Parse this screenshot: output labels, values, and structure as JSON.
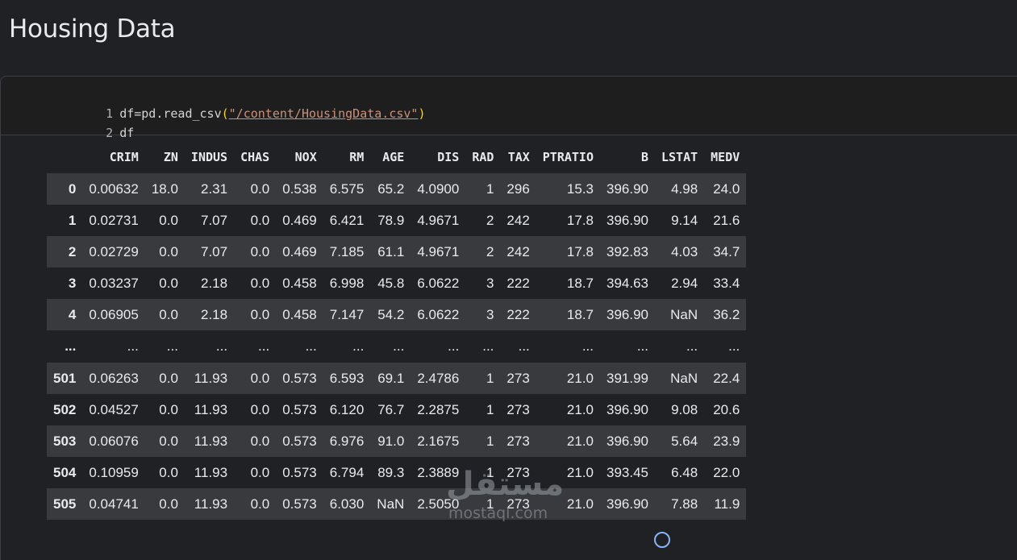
{
  "heading": "Housing Data",
  "code": {
    "lines": [
      {
        "num": "1",
        "pre": "df=pd.read_csv",
        "open": "(",
        "str": "\"/content/HousingData.csv\"",
        "close": ")"
      },
      {
        "num": "2",
        "text": "df"
      }
    ]
  },
  "table": {
    "columns": [
      "",
      "CRIM",
      "ZN",
      "INDUS",
      "CHAS",
      "NOX",
      "RM",
      "AGE",
      "DIS",
      "RAD",
      "TAX",
      "PTRATIO",
      "B",
      "LSTAT",
      "MEDV"
    ],
    "rows": [
      [
        "0",
        "0.00632",
        "18.0",
        "2.31",
        "0.0",
        "0.538",
        "6.575",
        "65.2",
        "4.0900",
        "1",
        "296",
        "15.3",
        "396.90",
        "4.98",
        "24.0"
      ],
      [
        "1",
        "0.02731",
        "0.0",
        "7.07",
        "0.0",
        "0.469",
        "6.421",
        "78.9",
        "4.9671",
        "2",
        "242",
        "17.8",
        "396.90",
        "9.14",
        "21.6"
      ],
      [
        "2",
        "0.02729",
        "0.0",
        "7.07",
        "0.0",
        "0.469",
        "7.185",
        "61.1",
        "4.9671",
        "2",
        "242",
        "17.8",
        "392.83",
        "4.03",
        "34.7"
      ],
      [
        "3",
        "0.03237",
        "0.0",
        "2.18",
        "0.0",
        "0.458",
        "6.998",
        "45.8",
        "6.0622",
        "3",
        "222",
        "18.7",
        "394.63",
        "2.94",
        "33.4"
      ],
      [
        "4",
        "0.06905",
        "0.0",
        "2.18",
        "0.0",
        "0.458",
        "7.147",
        "54.2",
        "6.0622",
        "3",
        "222",
        "18.7",
        "396.90",
        "NaN",
        "36.2"
      ],
      [
        "...",
        "...",
        "...",
        "...",
        "...",
        "...",
        "...",
        "...",
        "...",
        "...",
        "...",
        "...",
        "...",
        "...",
        "..."
      ],
      [
        "501",
        "0.06263",
        "0.0",
        "11.93",
        "0.0",
        "0.573",
        "6.593",
        "69.1",
        "2.4786",
        "1",
        "273",
        "21.0",
        "391.99",
        "NaN",
        "22.4"
      ],
      [
        "502",
        "0.04527",
        "0.0",
        "11.93",
        "0.0",
        "0.573",
        "6.120",
        "76.7",
        "2.2875",
        "1",
        "273",
        "21.0",
        "396.90",
        "9.08",
        "20.6"
      ],
      [
        "503",
        "0.06076",
        "0.0",
        "11.93",
        "0.0",
        "0.573",
        "6.976",
        "91.0",
        "2.1675",
        "1",
        "273",
        "21.0",
        "396.90",
        "5.64",
        "23.9"
      ],
      [
        "504",
        "0.10959",
        "0.0",
        "11.93",
        "0.0",
        "0.573",
        "6.794",
        "89.3",
        "2.3889",
        "1",
        "273",
        "21.0",
        "393.45",
        "6.48",
        "22.0"
      ],
      [
        "505",
        "0.04741",
        "0.0",
        "11.93",
        "0.0",
        "0.573",
        "6.030",
        "NaN",
        "2.5050",
        "1",
        "273",
        "21.0",
        "396.90",
        "7.88",
        "11.9"
      ]
    ]
  },
  "watermark": {
    "arabic": "مستقل",
    "latin": "mostaql.com"
  },
  "colors": {
    "background": "#202124",
    "stripe": "#383a3e",
    "string": "#ce9178",
    "paren": "#ffd700"
  }
}
